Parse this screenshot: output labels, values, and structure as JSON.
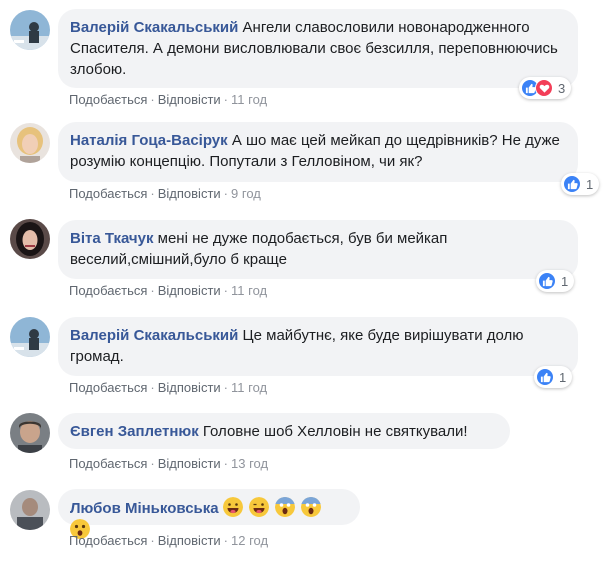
{
  "comments": [
    {
      "author": "Валерій Скакальський",
      "text": "Ангели славословили новонародженного Спасителя. А демони висловлювали своє безсилля, переповнюючись злобою.",
      "like_label": "Подобається",
      "reply_label": "Відповісти",
      "time": "11 год",
      "reaction_count": "3",
      "reactions": [
        "like-icon",
        "love-icon"
      ]
    },
    {
      "author": "Наталія Гоца-Васірук",
      "text": "А шо має цей мейкап до щедрівників? Не дуже розумію концепцію. Попутали з Гелловіном, чи як?",
      "like_label": "Подобається",
      "reply_label": "Відповісти",
      "time": "9 год",
      "reaction_count": "1",
      "reactions": [
        "like-icon"
      ]
    },
    {
      "author": "Віта Ткачук",
      "text": "мені не дуже подобається, був би мейкап веселий,смішний,було б краще",
      "like_label": "Подобається",
      "reply_label": "Відповісти",
      "time": "11 год",
      "reaction_count": "1",
      "reactions": [
        "like-icon"
      ]
    },
    {
      "author": "Валерій Скакальський",
      "text": "Це майбутнє, яке буде вирішувати долю громад.",
      "like_label": "Подобається",
      "reply_label": "Відповісти",
      "time": "11 год",
      "reaction_count": "1",
      "reactions": [
        "like-icon"
      ]
    },
    {
      "author": "Євген Заплетнюк",
      "text": "Головне шоб Хелловін не святкували!",
      "like_label": "Подобається",
      "reply_label": "Відповісти",
      "time": "13 год",
      "reaction_count": "",
      "reactions": []
    },
    {
      "author": "Любов Міньковська",
      "text": "",
      "emojis": [
        "grinning-tongue-emoji",
        "winking-tongue-emoji",
        "screaming-emoji",
        "screaming-emoji",
        "astonished-emoji"
      ],
      "like_label": "Подобається",
      "reply_label": "Відповісти",
      "time": "12 год",
      "reaction_count": "",
      "reactions": []
    }
  ],
  "colors": {
    "author": "#385898",
    "bubble": "#f2f3f5",
    "like": "#3b82f6",
    "love": "#f33e58",
    "meta": "#90949c"
  }
}
